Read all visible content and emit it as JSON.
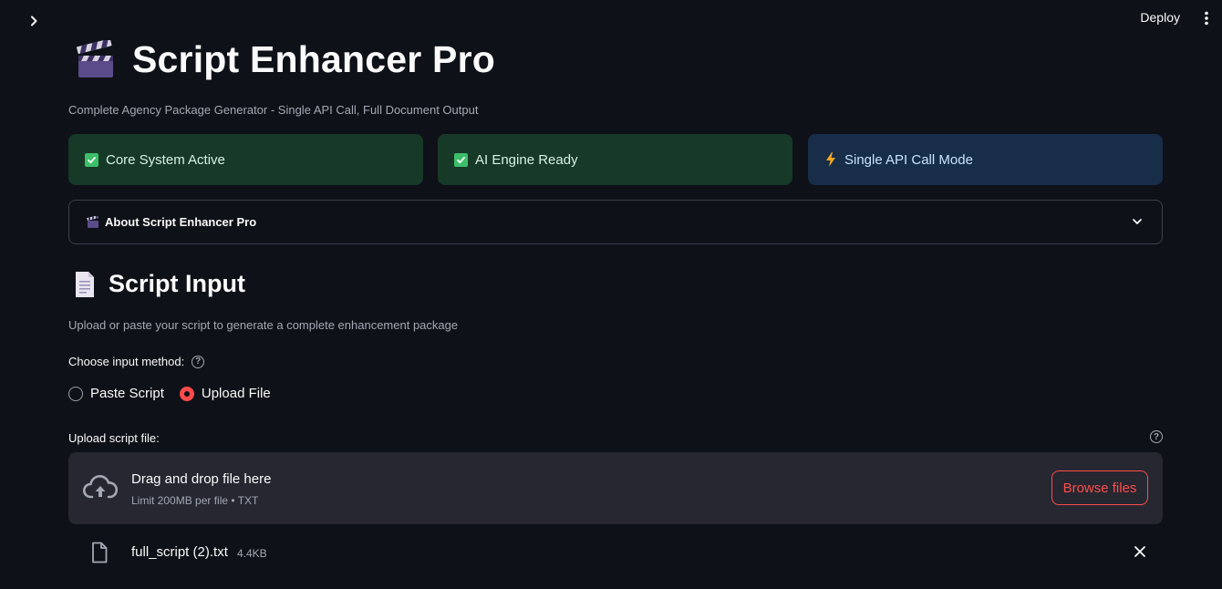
{
  "topbar": {
    "deploy_label": "Deploy"
  },
  "header": {
    "title": "Script Enhancer Pro",
    "subtitle": "Complete Agency Package Generator - Single API Call, Full Document Output"
  },
  "status_cards": [
    {
      "label": "Core System Active",
      "icon": "check-icon",
      "color": "#173928"
    },
    {
      "label": "AI Engine Ready",
      "icon": "check-icon",
      "color": "#173928"
    },
    {
      "label": "Single API Call Mode",
      "icon": "lightning-icon",
      "color": "#172d48"
    }
  ],
  "expander": {
    "label": "About Script Enhancer Pro",
    "icon": "clapper-icon",
    "expanded": false
  },
  "input_section": {
    "title": "Script Input",
    "description": "Upload or paste your script to generate a complete enhancement package",
    "method_label": "Choose input method:",
    "options": [
      "Paste Script",
      "Upload File"
    ],
    "selected": "Upload File"
  },
  "uploader": {
    "label": "Upload script file:",
    "drop_text": "Drag and drop file here",
    "limit_text": "Limit 200MB per file • TXT",
    "browse_label": "Browse files"
  },
  "uploaded_file": {
    "name": "full_script (2).txt",
    "size": "4.4KB"
  },
  "colors": {
    "background": "#0e1117",
    "accent": "#ff4b4b",
    "panel": "#262730"
  }
}
